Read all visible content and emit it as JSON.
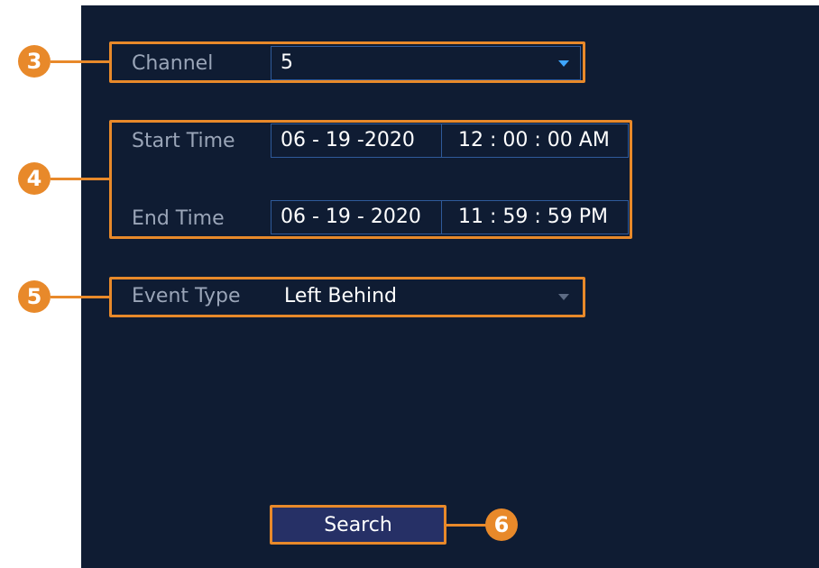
{
  "form": {
    "channel": {
      "label": "Channel",
      "value": "5",
      "icon": "dropdown-caret-icon"
    },
    "start_time": {
      "label": "Start Time",
      "date": "06 - 19 -2020",
      "time": "12 : 00 : 00 AM"
    },
    "end_time": {
      "label": "End Time",
      "date": "06 - 19 - 2020",
      "time": "11 : 59 : 59 PM"
    },
    "event_type": {
      "label": "Event Type",
      "value": "Left Behind",
      "icon": "dropdown-caret-icon"
    },
    "search_label": "Search"
  },
  "callouts": [
    "3",
    "4",
    "5",
    "6"
  ],
  "colors": {
    "background": "#0f1c33",
    "highlight": "#e8892a",
    "field_border": "#2f5a9a",
    "button": "#263066",
    "label_text": "#9aa5b8",
    "accent_caret": "#3ea6ff"
  }
}
